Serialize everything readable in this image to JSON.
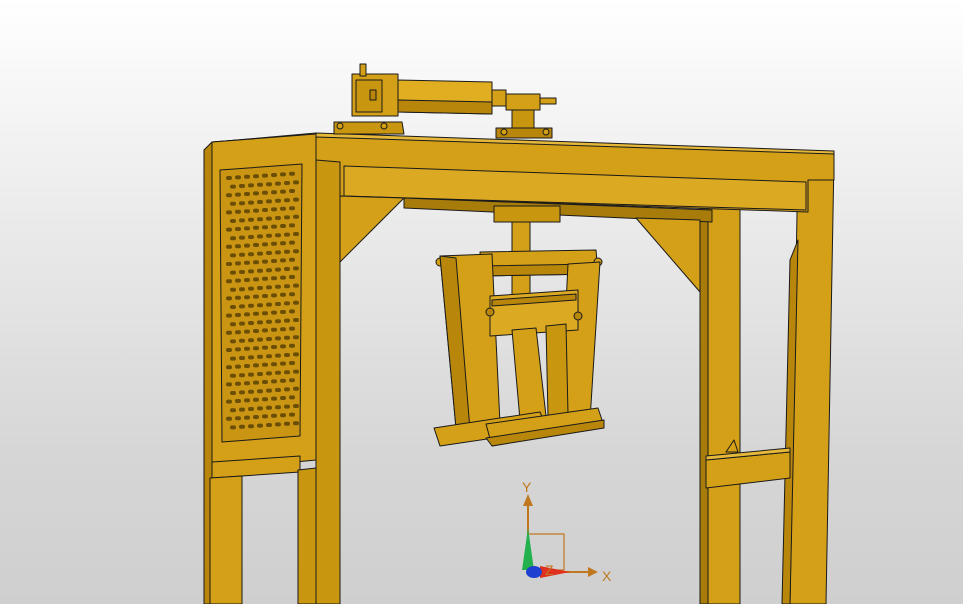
{
  "viewport": {
    "background_top": "#ffffff",
    "background_bottom": "#cfcfcf"
  },
  "model": {
    "body_color": "#d4a017",
    "shade_color": "#b8860b",
    "dark_color": "#8a6508",
    "edge_color": "#1a1a1a"
  },
  "triad": {
    "x_label": "X",
    "y_label": "Y",
    "z_label": "Z",
    "x_color": "#e0301e",
    "y_color": "#22b14c",
    "z_color": "#1f3fd1",
    "label_color": "#c07820"
  }
}
